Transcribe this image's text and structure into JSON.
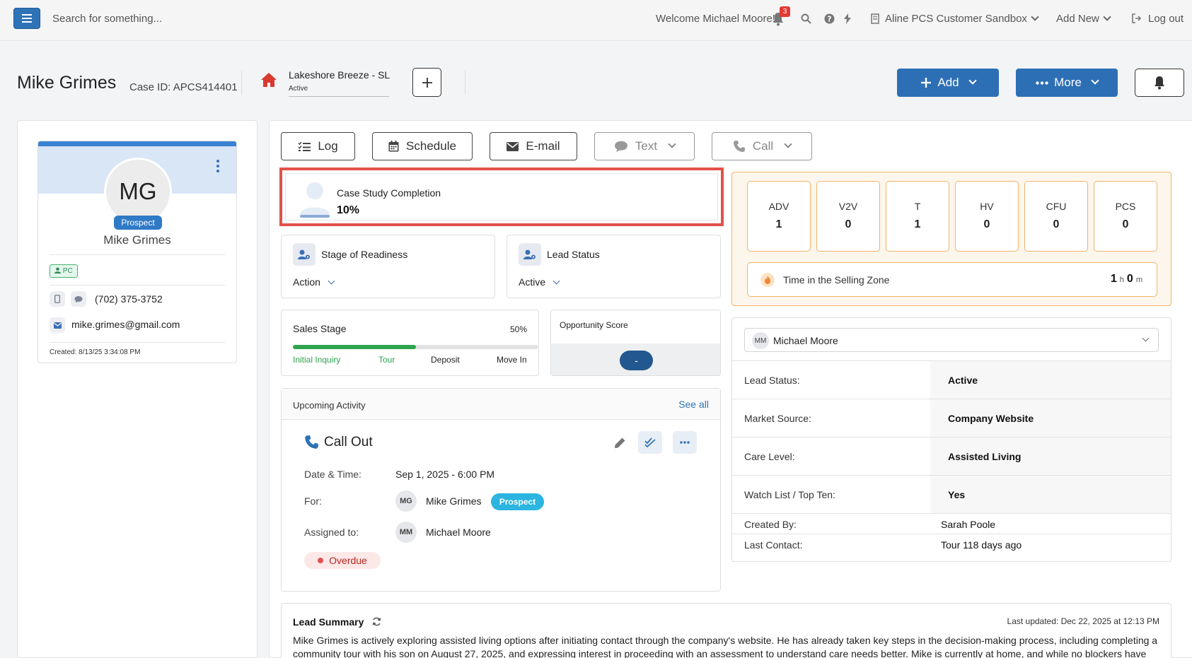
{
  "topbar": {
    "search_placeholder": "Search for something...",
    "welcome": "Welcome Michael Moore!",
    "notification_count": "3",
    "org_name": "Aline PCS Customer Sandbox",
    "add_new": "Add New",
    "logout": "Log out"
  },
  "header": {
    "name": "Mike Grimes",
    "case_id": "Case ID: APCS414401",
    "community_name": "Lakeshore Breeze - SL",
    "community_status": "Active",
    "add_label": "Add",
    "more_label": "More"
  },
  "profile": {
    "initials": "MG",
    "badge": "Prospect",
    "name": "Mike Grimes",
    "tag": "PC",
    "phone": "(702) 375-3752",
    "email": "mike.grimes@gmail.com",
    "created": "Created: 8/13/25 3:34:08 PM"
  },
  "actions": {
    "log": "Log",
    "schedule": "Schedule",
    "email": "E-mail",
    "text": "Text",
    "call": "Call"
  },
  "completion": {
    "label": "Case Study Completion",
    "value": "10%"
  },
  "readiness": {
    "label": "Stage of Readiness",
    "value": "Action"
  },
  "lead_status": {
    "label": "Lead Status",
    "value": "Active"
  },
  "sales_stage": {
    "label": "Sales Stage",
    "percent": "50%",
    "progress": 0.5,
    "stages": [
      "Initial Inquiry",
      "Tour",
      "Deposit",
      "Move In"
    ],
    "completed_color": "#2ea44f"
  },
  "opportunity": {
    "label": "Opportunity Score",
    "value": "-"
  },
  "upcoming": {
    "title": "Upcoming Activity",
    "see_all": "See all",
    "activity_title": "Call Out",
    "date_label": "Date & Time:",
    "date_value": "Sep 1, 2025 - 6:00 PM",
    "for_label": "For:",
    "for_initials": "MG",
    "for_name": "Mike Grimes",
    "for_badge": "Prospect",
    "assigned_label": "Assigned to:",
    "assigned_initials": "MM",
    "assigned_name": "Michael Moore",
    "status": "Overdue"
  },
  "metrics": [
    {
      "label": "ADV",
      "value": "1"
    },
    {
      "label": "V2V",
      "value": "0"
    },
    {
      "label": "T",
      "value": "1"
    },
    {
      "label": "HV",
      "value": "0"
    },
    {
      "label": "CFU",
      "value": "0"
    },
    {
      "label": "PCS",
      "value": "0"
    }
  ],
  "selling_zone": {
    "label": "Time in the Selling Zone",
    "hours": "1",
    "hours_unit": "h",
    "minutes": "0",
    "minutes_unit": "m"
  },
  "details": {
    "owner_initials": "MM",
    "owner_name": "Michael Moore",
    "rows": [
      {
        "key": "Lead Status:",
        "value": "Active"
      },
      {
        "key": "Market Source:",
        "value": "Company Website"
      },
      {
        "key": "Care Level:",
        "value": "Assisted Living"
      },
      {
        "key": "Watch List / Top Ten:",
        "value": "Yes"
      },
      {
        "key": "Created By:",
        "value": "Sarah Poole"
      },
      {
        "key": "Last Contact:",
        "value": "Tour 118 days ago"
      }
    ]
  },
  "summary": {
    "title": "Lead Summary",
    "updated": "Last updated: Dec 22, 2025 at 12:13 PM",
    "text": "Mike Grimes is actively exploring assisted living options after initiating contact through the company's website. He has already taken key steps in the decision-making process, including completing a community tour with his son on August 27, 2025, and expressing interest in proceeding with an assessment to understand care needs better. Mike is currently at home, and while no blockers have"
  }
}
